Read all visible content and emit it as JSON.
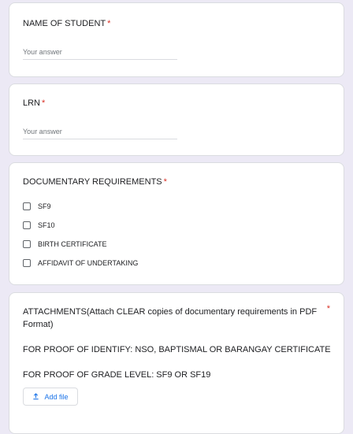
{
  "questions": [
    {
      "title": "NAME OF STUDENT",
      "required_mark": "*",
      "placeholder": "Your answer"
    },
    {
      "title": "LRN",
      "required_mark": "*",
      "placeholder": "Your answer"
    }
  ],
  "documentary": {
    "title": "DOCUMENTARY REQUIREMENTS",
    "required_mark": "*",
    "options": [
      "SF9",
      "SF10",
      "BIRTH CERTIFICATE",
      "AFFIDAVIT OF UNDERTAKING"
    ]
  },
  "attachments": {
    "title": "ATTACHMENTS(Attach CLEAR copies of documentary requirements in PDF Format)",
    "required_mark": "*",
    "proof_identity": "FOR PROOF OF IDENTIFY: NSO, BAPTISMAL OR BARANGAY CERTIFICATE",
    "proof_grade": "FOR PROOF OF GRADE LEVEL: SF9 OR SF19",
    "add_file_label": "Add file",
    "add_file_icon": "upload-icon"
  },
  "colors": {
    "background": "#ece9f5",
    "required": "#d93025",
    "link": "#1a73e8"
  }
}
